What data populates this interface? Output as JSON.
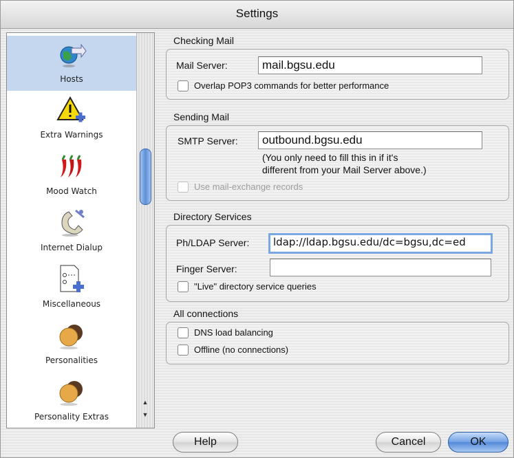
{
  "window": {
    "title": "Settings"
  },
  "sidebar": {
    "items": [
      {
        "label": "Hosts",
        "icon": "globe-arrow-icon",
        "selected": true
      },
      {
        "label": "Extra Warnings",
        "icon": "warning-icon",
        "selected": false
      },
      {
        "label": "Mood Watch",
        "icon": "chili-peppers-icon",
        "selected": false
      },
      {
        "label": "Internet Dialup",
        "icon": "telephone-icon",
        "selected": false
      },
      {
        "label": "Miscellaneous",
        "icon": "document-plus-icon",
        "selected": false
      },
      {
        "label": "Personalities",
        "icon": "faces-icon",
        "selected": false
      },
      {
        "label": "Personality Extras",
        "icon": "faces-icon",
        "selected": false
      }
    ]
  },
  "checking_mail": {
    "title": "Checking Mail",
    "mail_server_label": "Mail Server:",
    "mail_server_value": "mail.bgsu.edu",
    "overlap_label": "Overlap POP3 commands for better performance",
    "overlap_checked": false
  },
  "sending_mail": {
    "title": "Sending Mail",
    "smtp_label": "SMTP Server:",
    "smtp_value": "outbound.bgsu.edu",
    "note_line1": "(You only need to fill this in if it's",
    "note_line2": "different from your Mail Server above.)",
    "mx_label": "Use mail-exchange records",
    "mx_checked": false,
    "mx_enabled": false
  },
  "directory_services": {
    "title": "Directory Services",
    "ldap_label": "Ph/LDAP Server:",
    "ldap_value": "ldap://ldap.bgsu.edu/dc=bgsu,dc=ed",
    "finger_label": "Finger Server:",
    "finger_value": "",
    "live_label": "\"Live\" directory service queries",
    "live_checked": false
  },
  "all_connections": {
    "title": "All connections",
    "dns_label": "DNS load balancing",
    "dns_checked": false,
    "offline_label": "Offline (no connections)",
    "offline_checked": false
  },
  "buttons": {
    "help": "Help",
    "cancel": "Cancel",
    "ok": "OK"
  },
  "colors": {
    "selection": "#c5d7ef",
    "focus": "#7aa7e2",
    "default_button": "#5389d9"
  }
}
